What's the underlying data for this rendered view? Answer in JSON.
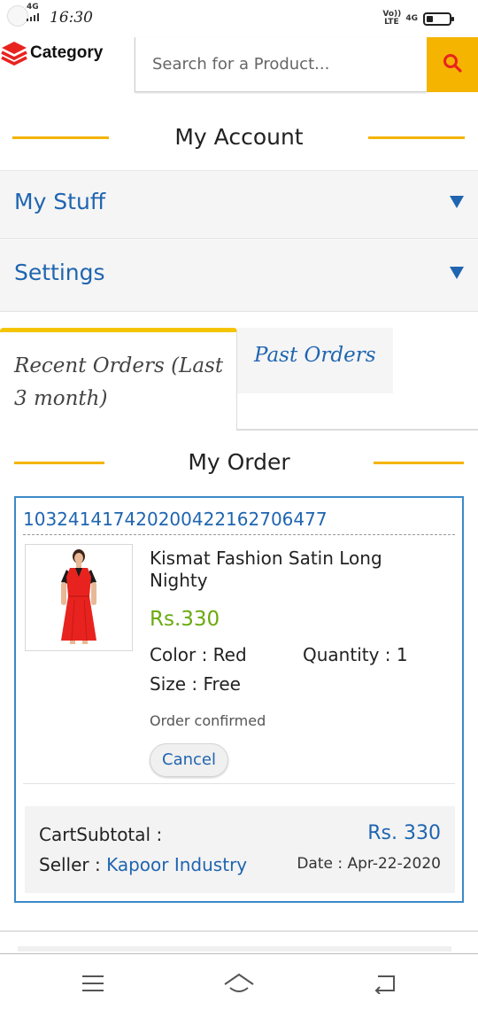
{
  "status_bar": {
    "network_signal": "4G",
    "time": "16:30",
    "volte": "Vo)) LTE",
    "network_right": "4G",
    "battery_level": 0.3
  },
  "header": {
    "category_label": "Category",
    "search_placeholder": "Search for a Product...",
    "search_icon": "search-icon"
  },
  "account": {
    "title": "My Account",
    "sections": [
      {
        "label": "My Stuff"
      },
      {
        "label": "Settings"
      }
    ]
  },
  "tabs": {
    "recent_label": "Recent Orders (Last 3 month)",
    "past_label": "Past Orders"
  },
  "my_order": {
    "title": "My Order",
    "order": {
      "id": "103241417420200422162706477",
      "product_name": "Kismat Fashion Satin Long Nighty",
      "price": "Rs.330",
      "color": "Color : Red",
      "quantity": "Quantity : 1",
      "size": "Size : Free",
      "status": "Order confirmed",
      "cancel_label": "Cancel",
      "subtotal_label": "CartSubtotal :",
      "subtotal_value": "Rs. 330",
      "seller_prefix": "Seller : ",
      "seller_name": "Kapoor Industry",
      "date": "Date : Apr-22-2020"
    }
  },
  "colors": {
    "accent": "#f5b400",
    "link_blue": "#1f65b0",
    "price_green": "#6aaa10",
    "product_red": "#e8231f"
  },
  "nav": {
    "menu_icon": "menu-icon",
    "home_icon": "home-icon",
    "back_icon": "back-icon"
  }
}
